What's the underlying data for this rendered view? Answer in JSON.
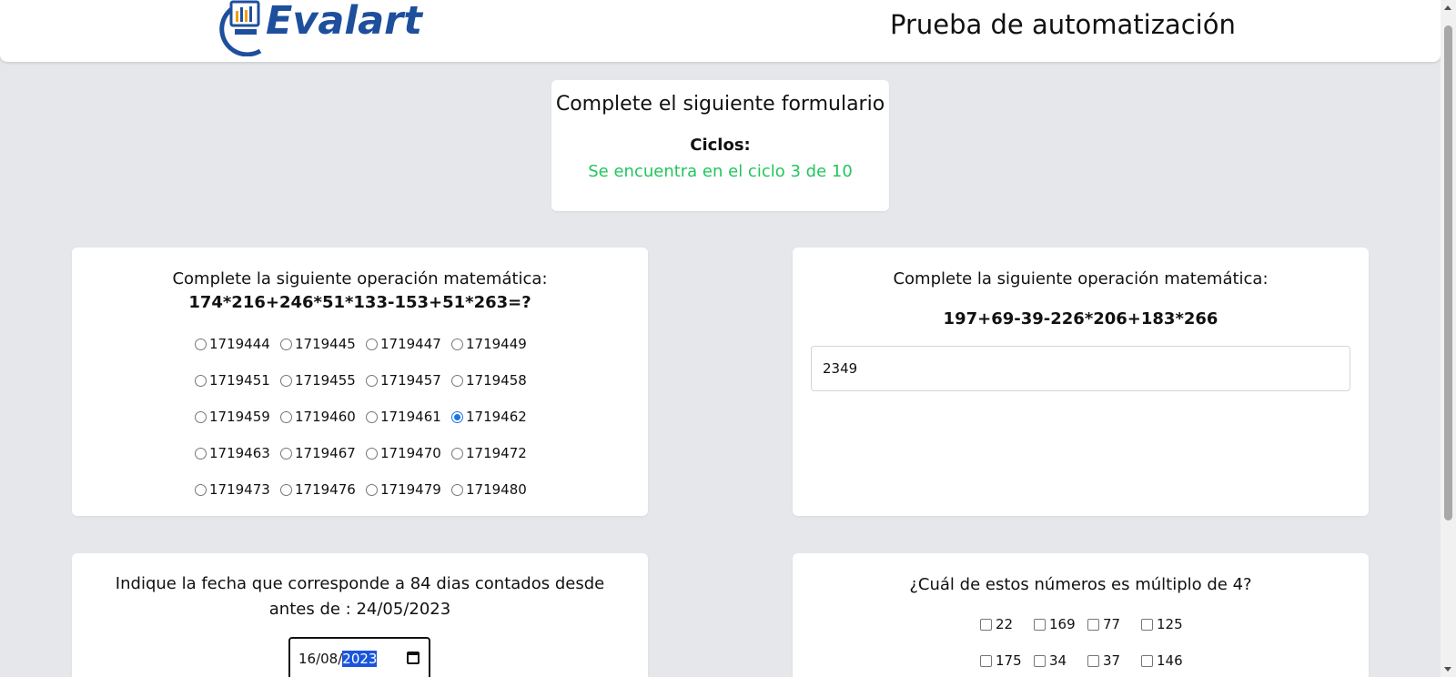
{
  "header": {
    "logo_text": "Evalart",
    "title": "Prueba de automatización"
  },
  "intro": {
    "title": "Complete el siguiente formulario",
    "cycles_label": "Ciclos:",
    "status": "Se encuentra en el ciclo 3 de 10"
  },
  "math1": {
    "question": "Complete la siguiente operación matemática:",
    "expression": "174*216+246*51*133-153+51*263=?",
    "options": [
      {
        "label": "1719444",
        "selected": false
      },
      {
        "label": "1719445",
        "selected": false
      },
      {
        "label": "1719447",
        "selected": false
      },
      {
        "label": "1719449",
        "selected": false
      },
      {
        "label": "1719451",
        "selected": false
      },
      {
        "label": "1719455",
        "selected": false
      },
      {
        "label": "1719457",
        "selected": false
      },
      {
        "label": "1719458",
        "selected": false
      },
      {
        "label": "1719459",
        "selected": false
      },
      {
        "label": "1719460",
        "selected": false
      },
      {
        "label": "1719461",
        "selected": false
      },
      {
        "label": "1719462",
        "selected": true
      },
      {
        "label": "1719463",
        "selected": false
      },
      {
        "label": "1719467",
        "selected": false
      },
      {
        "label": "1719470",
        "selected": false
      },
      {
        "label": "1719472",
        "selected": false
      },
      {
        "label": "1719473",
        "selected": false
      },
      {
        "label": "1719476",
        "selected": false
      },
      {
        "label": "1719479",
        "selected": false
      },
      {
        "label": "1719480",
        "selected": false
      }
    ]
  },
  "math2": {
    "question": "Complete la siguiente operación matemática:",
    "expression": "197+69-39-226*206+183*266",
    "answer_value": "2349"
  },
  "date_question": {
    "question": "Indique la fecha que corresponde a 84 dias contados desde antes de : 24/05/2023",
    "date_day_month": "16/08/",
    "date_year_selected": "2023"
  },
  "multiple_question": {
    "question": "¿Cuál de estos números es múltiplo de 4?",
    "options": [
      "22",
      "169",
      "77",
      "125",
      "175",
      "34",
      "37",
      "146"
    ]
  },
  "colors": {
    "accent": "#1a73e8",
    "status_green": "#22c55e",
    "logo_blue": "#1e4f9c",
    "background": "#e5e7eb"
  }
}
